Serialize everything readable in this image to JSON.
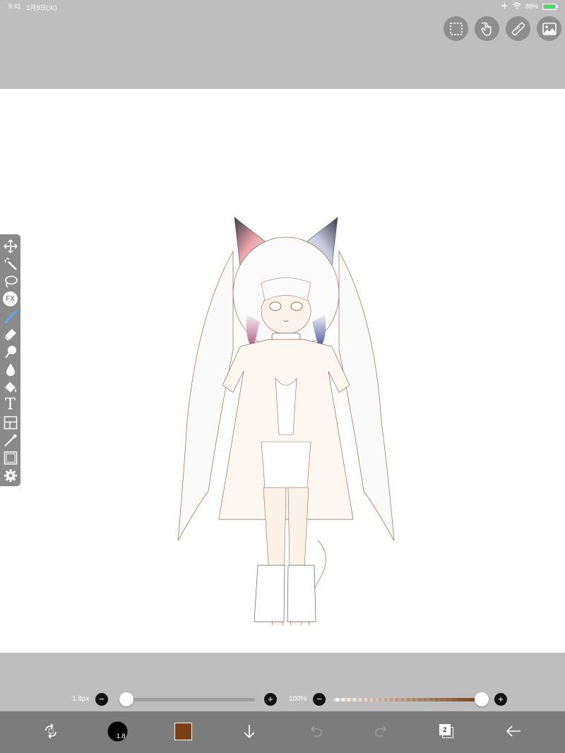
{
  "status_bar": {
    "time": "9:41",
    "date": "1月9日(火)",
    "battery_percent": "88%",
    "battery_level": 0.88
  },
  "top_actions": [
    {
      "name": "selection-icon"
    },
    {
      "name": "hand-gesture-icon"
    },
    {
      "name": "ruler-icon"
    },
    {
      "name": "image-icon"
    }
  ],
  "left_toolbar": {
    "tools": [
      {
        "name": "move-icon"
      },
      {
        "name": "magic-wand-icon"
      },
      {
        "name": "lasso-icon"
      },
      {
        "name": "fx-icon",
        "label": "FX"
      },
      {
        "name": "brush-icon",
        "active": true
      },
      {
        "name": "eraser-icon"
      },
      {
        "name": "smudge-icon"
      },
      {
        "name": "blur-drop-icon"
      },
      {
        "name": "bucket-fill-icon"
      },
      {
        "name": "text-icon",
        "label": "T"
      },
      {
        "name": "frame-divider-icon"
      },
      {
        "name": "eyedropper-icon"
      },
      {
        "name": "canvas-frame-icon"
      },
      {
        "name": "settings-gear-icon"
      }
    ]
  },
  "brush_size_slider": {
    "label": "1.8px",
    "minus": "−",
    "plus": "+",
    "value_fraction": 0.02
  },
  "opacity_slider": {
    "label": "100%",
    "minus": "−",
    "plus": "+",
    "value_fraction": 1.0
  },
  "bottom_bar": {
    "brush_size_display": "1.8",
    "current_color": "#7a3f12",
    "layer_count": "2"
  },
  "colors": {
    "canvas": "#ffffff",
    "workspace": "#bebebe",
    "toolbar": "#8a8a8a",
    "bottom_bar": "#7c7c7c",
    "active_tool": "#5aa9ff"
  }
}
